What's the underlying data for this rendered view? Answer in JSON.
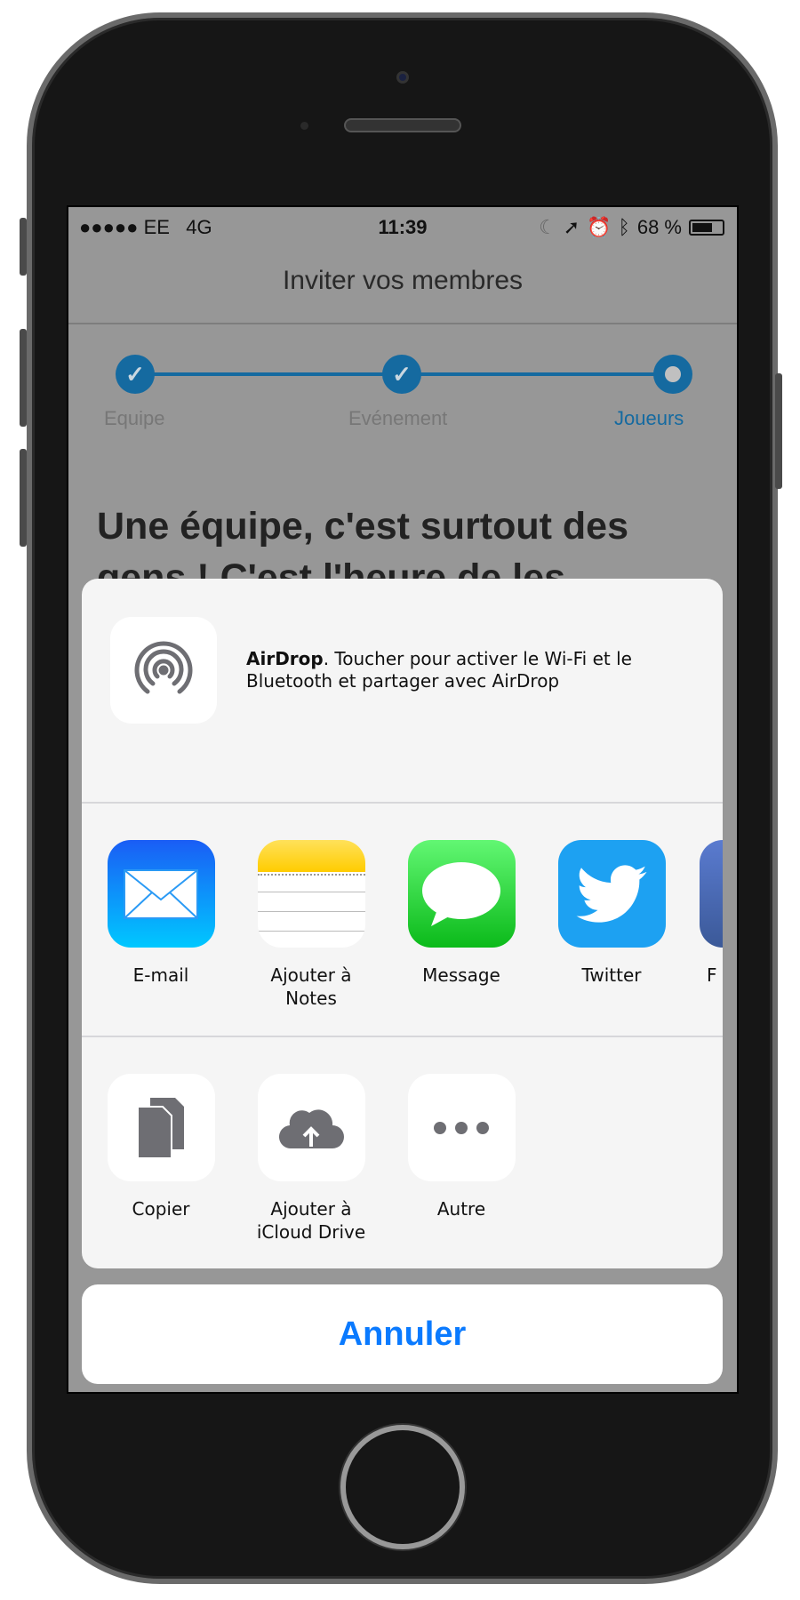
{
  "status_bar": {
    "signal": "●●●●●",
    "carrier": "EE",
    "network": "4G",
    "time": "11:39",
    "battery_text": "68 %",
    "battery_level": 0.68
  },
  "nav": {
    "title": "Inviter vos membres"
  },
  "stepper": {
    "accent": "#156aa0",
    "steps": [
      {
        "label": "Equipe",
        "state": "done"
      },
      {
        "label": "Evénement",
        "state": "done"
      },
      {
        "label": "Joueurs",
        "state": "current"
      }
    ]
  },
  "content": {
    "heading": "Une équipe, c'est surtout des gens ! C'est l'heure de les"
  },
  "share_sheet": {
    "airdrop": {
      "title": "AirDrop",
      "description": ". Toucher pour activer le Wi-Fi et le Bluetooth et partager avec AirDrop"
    },
    "apps": [
      {
        "label": "E-mail",
        "icon": "mail-icon"
      },
      {
        "label": "Ajouter à Notes",
        "icon": "notes-icon"
      },
      {
        "label": "Message",
        "icon": "messages-icon"
      },
      {
        "label": "Twitter",
        "icon": "twitter-icon"
      },
      {
        "label": "F",
        "icon": "facebook-icon"
      }
    ],
    "actions": [
      {
        "label": "Copier",
        "icon": "copy-icon"
      },
      {
        "label": "Ajouter à iCloud Drive",
        "icon": "icloud-upload-icon"
      },
      {
        "label": "Autre",
        "icon": "more-icon"
      }
    ],
    "cancel_label": "Annuler",
    "cancel_color": "#0a7aff"
  }
}
